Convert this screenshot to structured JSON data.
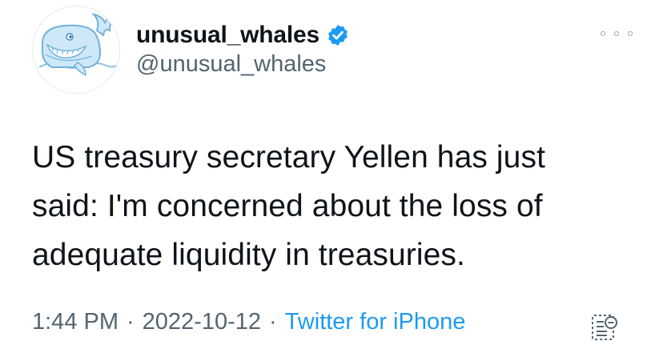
{
  "author": {
    "display_name": "unusual_whales",
    "handle": "@unusual_whales",
    "verified": true,
    "avatar_icon": "whale-logo"
  },
  "tweet": {
    "text": "US treasury secretary Yellen has just\nsaid: I'm concerned about the loss of\nadequate liquidity in treasuries."
  },
  "meta": {
    "time": "1:44 PM",
    "separator": "·",
    "date": "2022-10-12",
    "source": "Twitter for iPhone"
  },
  "icons": {
    "more": "more-options-icon",
    "verified": "verified-badge-icon",
    "activity": "tweet-activity-icon"
  },
  "colors": {
    "accent": "#1d9bf0",
    "text_primary": "#0f1419",
    "text_secondary": "#536471",
    "verified_badge": "#1d9bf0"
  }
}
